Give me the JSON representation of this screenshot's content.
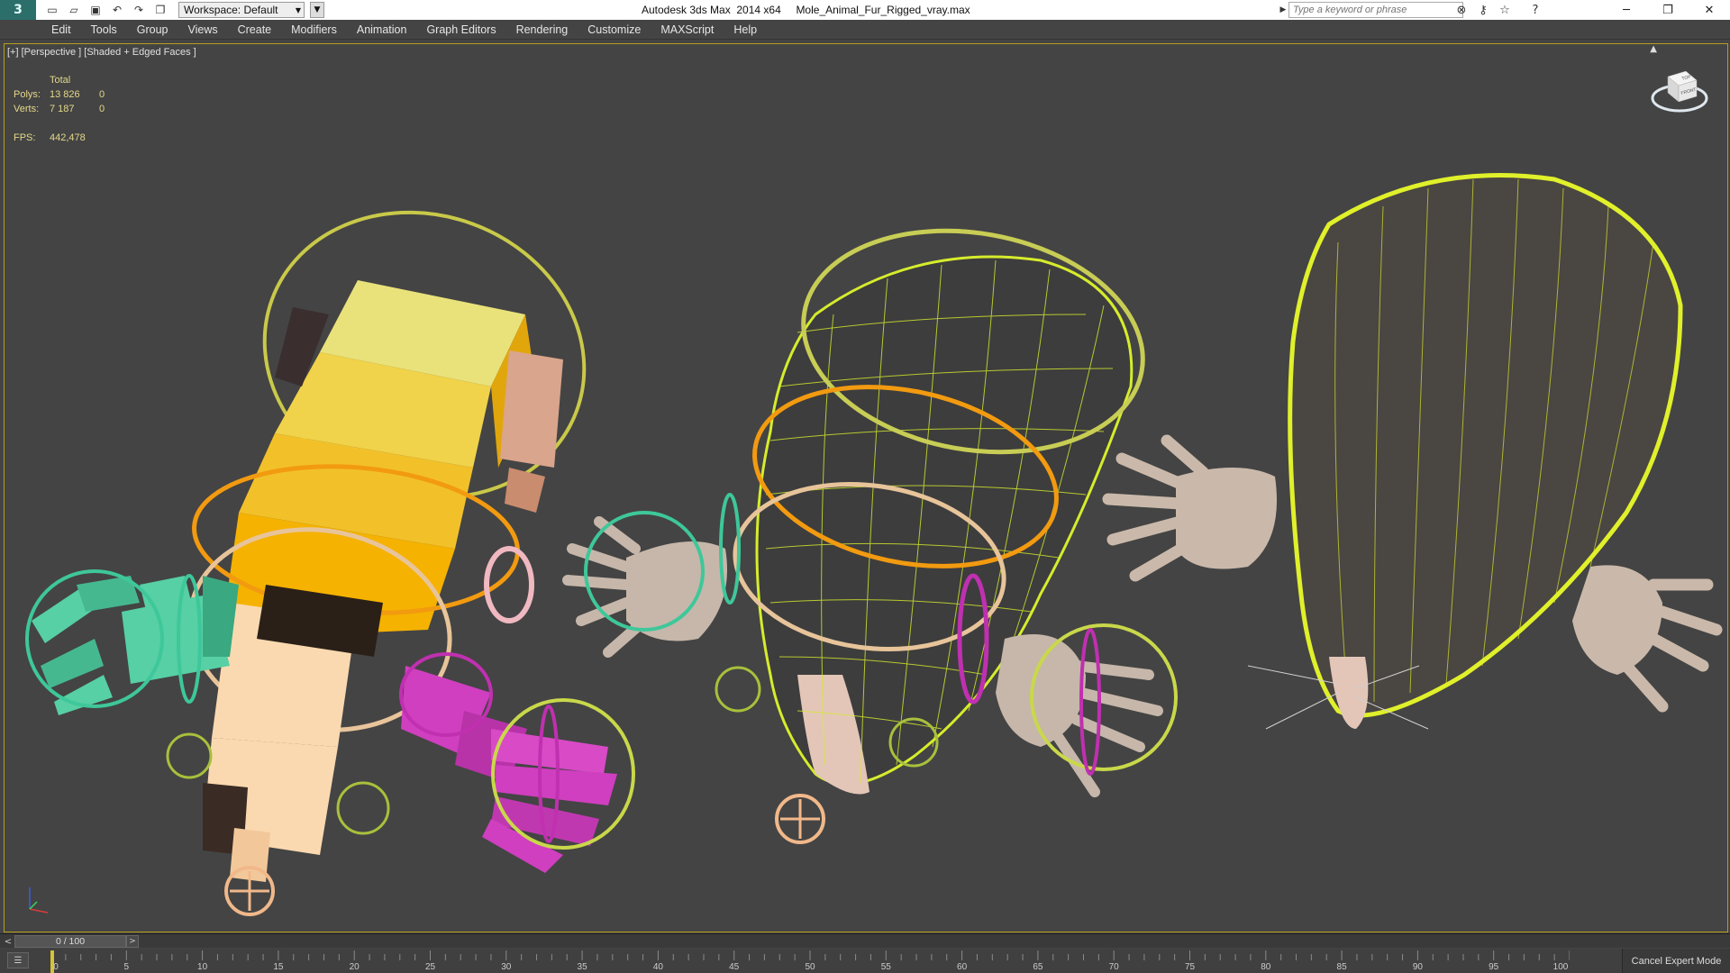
{
  "titlebar": {
    "logo_glyph": "3",
    "workspace_label": "Workspace: Default",
    "app_title": "Autodesk 3ds Max  2014 x64",
    "file_name": "Mole_Animal_Fur_Rigged_vray.max",
    "search_placeholder": "Type a keyword or phrase",
    "qat_icons": [
      "new-file-icon",
      "open-file-icon",
      "save-icon",
      "undo-icon",
      "redo-icon",
      "project-folder-icon"
    ],
    "tool_icons": [
      "binoculars-icon",
      "search-key-icon",
      "exchange-star-icon",
      "help-icon"
    ]
  },
  "menubar": {
    "items": [
      "Edit",
      "Tools",
      "Group",
      "Views",
      "Create",
      "Modifiers",
      "Animation",
      "Graph Editors",
      "Rendering",
      "Customize",
      "MAXScript",
      "Help"
    ]
  },
  "viewport": {
    "label": "[+] [Perspective ] [Shaded + Edged Faces ]",
    "stats": {
      "header": "Total",
      "polys_label": "Polys:",
      "polys_value": "13 826",
      "polys_sel": "0",
      "verts_label": "Verts:",
      "verts_value": "7 187",
      "verts_sel": "0",
      "fps_label": "FPS:",
      "fps_value": "442,478"
    },
    "viewcube": {
      "top_label": "TOP",
      "front_label": "FRONT"
    },
    "highlight_color": "#b59e1e"
  },
  "timeline": {
    "slider_text": "0 / 100",
    "ticks": [
      "0",
      "5",
      "10",
      "15",
      "20",
      "25",
      "30",
      "35",
      "40",
      "45",
      "50",
      "55",
      "60",
      "65",
      "70",
      "75",
      "80",
      "85",
      "90",
      "95",
      "100"
    ],
    "cancel_expert_label": "Cancel Expert Mode"
  }
}
